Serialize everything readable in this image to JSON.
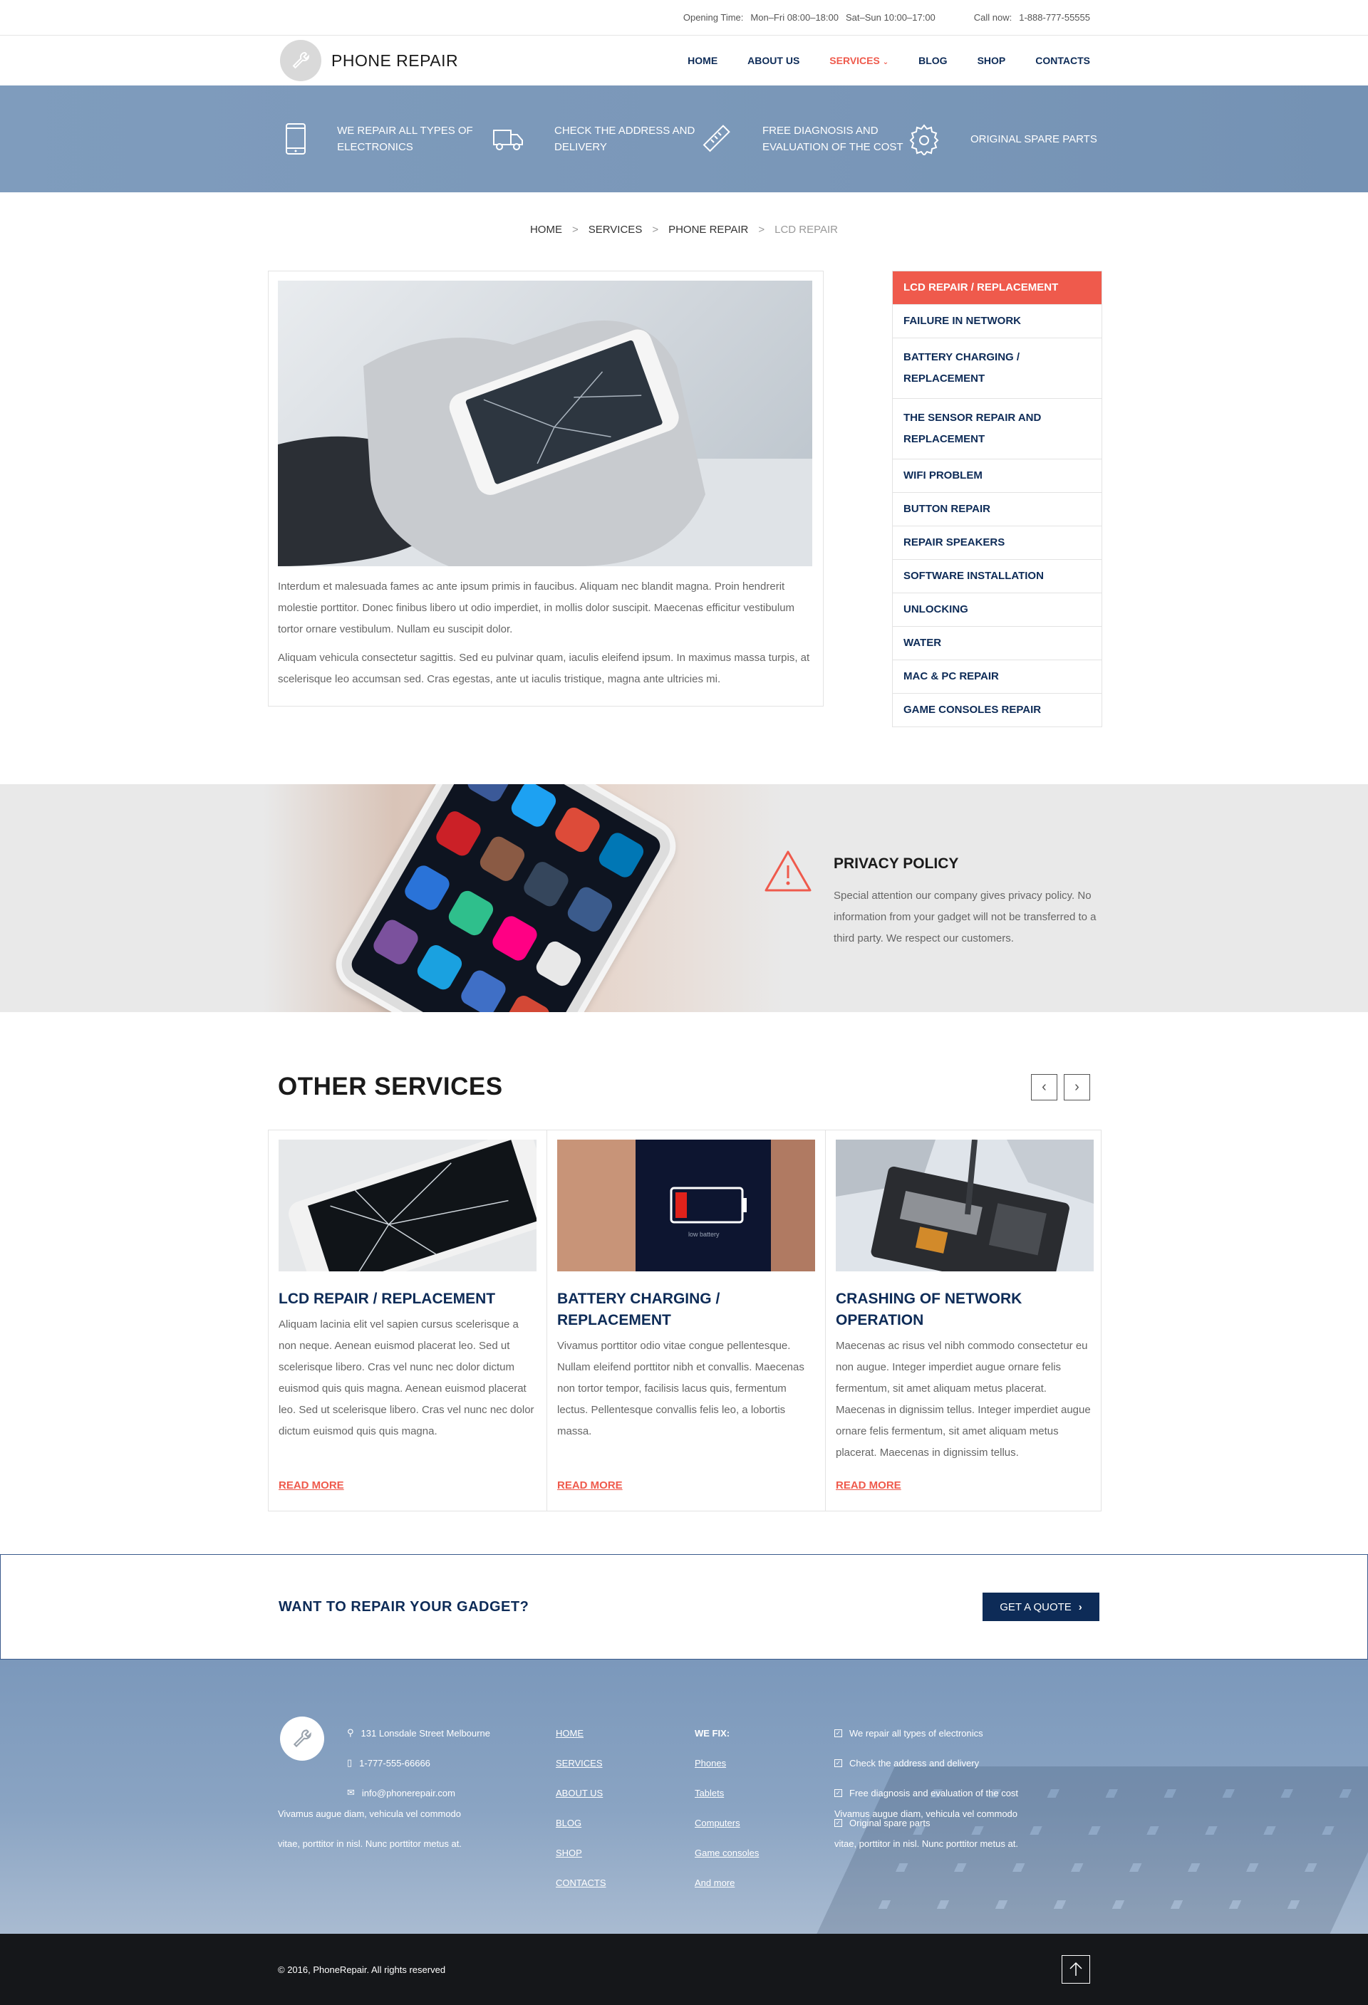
{
  "topbar": {
    "opening_label": "Opening Time:",
    "weekday_hours": "Mon–Fri 08:00–18:00",
    "weekend_hours": "Sat–Sun 10:00–17:00",
    "call_label": "Call now:",
    "phone": "1-888-777-55555"
  },
  "header": {
    "logo_text": "PHONE REPAIR",
    "nav": [
      "HOME",
      "ABOUT US",
      "SERVICES",
      "BLOG",
      "SHOP",
      "CONTACTS"
    ],
    "active_nav": "SERVICES"
  },
  "features": [
    {
      "icon": "phone-icon",
      "text": "We repair all types of electronics"
    },
    {
      "icon": "truck-icon",
      "text": "Check the address and delivery"
    },
    {
      "icon": "ruler-icon",
      "text": "Free diagnosis and evaluation of the cost"
    },
    {
      "icon": "gear-icon",
      "text": "Original spare parts"
    }
  ],
  "breadcrumb": [
    "HOME",
    "SERVICES",
    "PHONE REPAIR",
    "LCD REPAIR"
  ],
  "content": {
    "paragraphs": [
      "Interdum et malesuada fames ac ante ipsum primis in faucibus. Aliquam nec blandit magna. Proin hendrerit molestie porttitor. Donec finibus libero ut odio imperdiet, in mollis dolor suscipit. Maecenas efficitur vestibulum tortor ornare vestibulum. Nullam eu suscipit dolor.",
      "Aliquam vehicula consectetur sagittis. Sed eu pulvinar quam, iaculis eleifend ipsum. In maximus massa turpis, at scelerisque leo accumsan sed. Cras egestas, ante ut iaculis tristique, magna ante ultricies mi."
    ]
  },
  "side_menu": [
    "LCD REPAIR / REPLACEMENT",
    "FAILURE IN NETWORK",
    "BATTERY CHARGING / REPLACEMENT",
    "THE SENSOR REPAIR AND REPLACEMENT",
    "WIFI PROBLEM",
    "BUTTON REPAIR",
    "REPAIR SPEAKERS",
    "SOFTWARE INSTALLATION",
    "UNLOCKING",
    "WATER",
    "MAC & PC REPAIR",
    "GAME CONSOLES REPAIR"
  ],
  "privacy": {
    "title": "PRIVACY POLICY",
    "text": "Special attention our company gives privacy policy. No information from your gadget will not be transferred to a third party. We respect our customers."
  },
  "other_services": {
    "title": "OTHER SERVICES",
    "cards": [
      {
        "title": "LCD REPAIR / REPLACEMENT",
        "text": "Aliquam lacinia elit vel sapien cursus scelerisque a non neque. Aenean euismod placerat leo. Sed ut scelerisque libero. Cras vel nunc nec dolor dictum euismod quis quis magna. Aenean euismod placerat leo. Sed ut scelerisque libero. Cras vel nunc nec dolor dictum euismod quis quis magna.",
        "more": "READ MORE"
      },
      {
        "title": "BATTERY CHARGING / REPLACEMENT",
        "text": "Vivamus porttitor odio vitae congue pellentesque. Nullam eleifend porttitor nibh et convallis. Maecenas non tortor tempor, facilisis lacus quis, fermentum lectus. Pellentesque convallis felis leo, a lobortis massa.",
        "more": "READ MORE",
        "battery_label": "low battery"
      },
      {
        "title": "CRASHING OF NETWORK OPERATION",
        "text": "Maecenas ac risus vel nibh commodo consectetur eu non augue. Integer imperdiet augue ornare felis fermentum, sit amet aliquam metus placerat. Maecenas in dignissim tellus. Integer imperdiet augue ornare felis fermentum, sit amet aliquam metus placerat. Maecenas in dignissim tellus.",
        "more": "READ MORE"
      }
    ]
  },
  "cta": {
    "title": "WANT TO REPAIR YOUR GADGET?",
    "button": "GET A QUOTE"
  },
  "footer": {
    "address": "131 Lonsdale Street Melbourne",
    "phone": "1-777-555-66666",
    "email": "info@phonerepair.com",
    "desc_left": "Vivamus augue diam, vehicula vel commodo vitae, porttitor in nisl. Nunc porttitor metus at.",
    "links": [
      "HOME",
      "SERVICES",
      "ABOUT US",
      "BLOG",
      "SHOP",
      "CONTACTS"
    ],
    "we_fix_title": "WE FIX:",
    "we_fix": [
      "Phones",
      "Tablets",
      "Computers",
      "Game consoles",
      "And more"
    ],
    "checks": [
      "We repair all types of electronics",
      "Check the address and delivery",
      "Free diagnosis and evaluation of the cost",
      "Original spare parts"
    ],
    "desc_right": "Vivamus augue diam, vehicula vel commodo vitae, porttitor in nisl. Nunc porttitor metus at.",
    "copyright": "© 2016, PhoneRepair. All rights reserved"
  },
  "colors": {
    "accent": "#ef5a4c",
    "navy": "#0d2b57",
    "band": "#7b98b9",
    "bottom": "#15171a"
  }
}
